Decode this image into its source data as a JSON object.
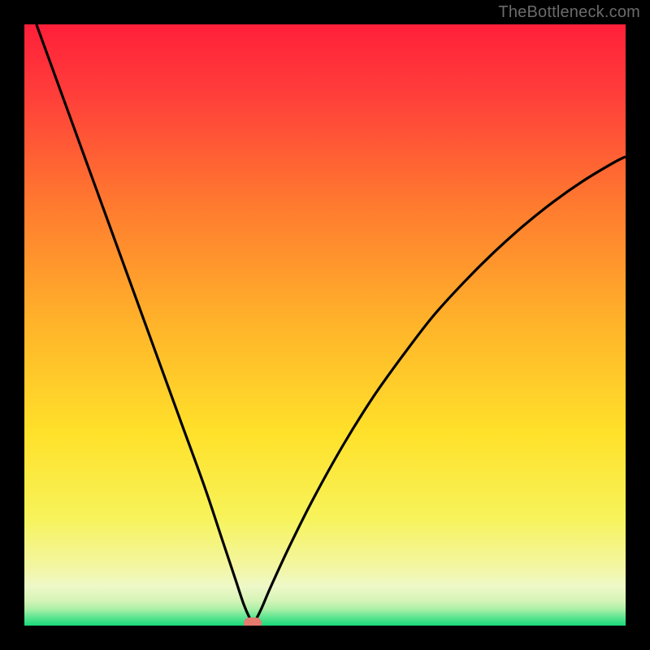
{
  "watermark": "TheBottleneck.com",
  "colors": {
    "frame": "#000000",
    "curve": "#000000",
    "marker": "#e37b6f",
    "gradient_stops": [
      {
        "offset": 0.0,
        "color": "#ff1f3a"
      },
      {
        "offset": 0.12,
        "color": "#ff3f3a"
      },
      {
        "offset": 0.3,
        "color": "#ff7a2f"
      },
      {
        "offset": 0.5,
        "color": "#ffb42a"
      },
      {
        "offset": 0.68,
        "color": "#ffe12a"
      },
      {
        "offset": 0.82,
        "color": "#f7f35a"
      },
      {
        "offset": 0.9,
        "color": "#f3f6a0"
      },
      {
        "offset": 0.935,
        "color": "#eef8c8"
      },
      {
        "offset": 0.958,
        "color": "#d6f4b8"
      },
      {
        "offset": 0.972,
        "color": "#aef0a8"
      },
      {
        "offset": 0.985,
        "color": "#63e693"
      },
      {
        "offset": 1.0,
        "color": "#18d879"
      }
    ]
  },
  "chart_data": {
    "type": "line",
    "title": "",
    "xlabel": "",
    "ylabel": "",
    "xlim": [
      0,
      100
    ],
    "ylim": [
      0,
      100
    ],
    "grid": false,
    "note": "V-shaped bottleneck curve. x is component balance (arbitrary 0-100), y is bottleneck percentage (0 at bottom, 100 at top). Minimum near x≈38 where bottleneck ≈0.",
    "series": [
      {
        "name": "bottleneck-curve",
        "x": [
          2,
          6,
          10,
          14,
          18,
          22,
          26,
          30,
          33,
          35,
          36.5,
          37.5,
          38,
          38.5,
          39.5,
          41,
          44,
          48,
          53,
          58,
          63,
          68,
          73,
          78,
          83,
          88,
          93,
          98,
          100
        ],
        "y": [
          100,
          89,
          78,
          67,
          56,
          45,
          34,
          23,
          14,
          8,
          3.5,
          1.2,
          0.4,
          1.0,
          3.0,
          6.5,
          13,
          21,
          30,
          38,
          45,
          51.5,
          57,
          62,
          66.5,
          70.5,
          74,
          77,
          78
        ]
      }
    ],
    "marker": {
      "x": 38,
      "y": 0.4,
      "label": "optimal-point"
    }
  }
}
